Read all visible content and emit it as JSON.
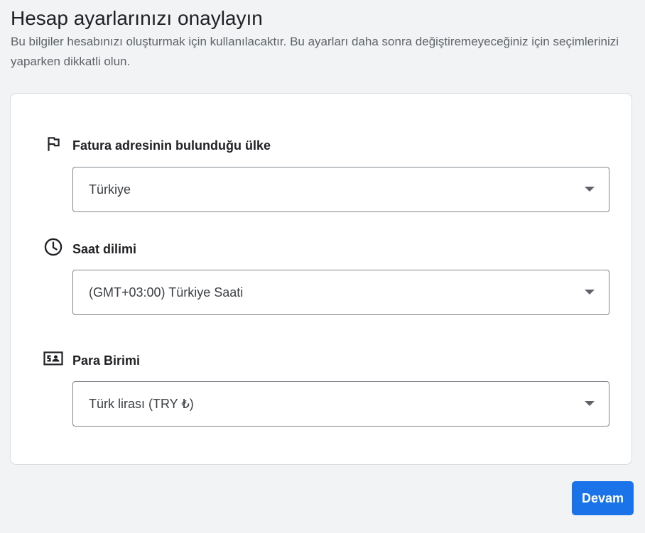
{
  "header": {
    "title": "Hesap ayarlarınızı onaylayın",
    "description": "Bu bilgiler hesabınızı oluşturmak için kullanılacaktır. Bu ayarları daha sonra değiştiremeyeceğiniz için seçimlerinizi yaparken dikkatli olun."
  },
  "fields": [
    {
      "icon": "flag-icon",
      "label": "Fatura adresinin bulunduğu ülke",
      "value": "Türkiye"
    },
    {
      "icon": "clock-icon",
      "label": "Saat dilimi",
      "value": "(GMT+03:00) Türkiye Saati"
    },
    {
      "icon": "currency-icon",
      "label": "Para Birimi",
      "value": "Türk lirası (TRY ₺)"
    }
  ],
  "actions": {
    "continue_label": "Devam"
  },
  "colors": {
    "primary": "#1a73e8",
    "background": "#f1f3f4",
    "card": "#ffffff"
  }
}
